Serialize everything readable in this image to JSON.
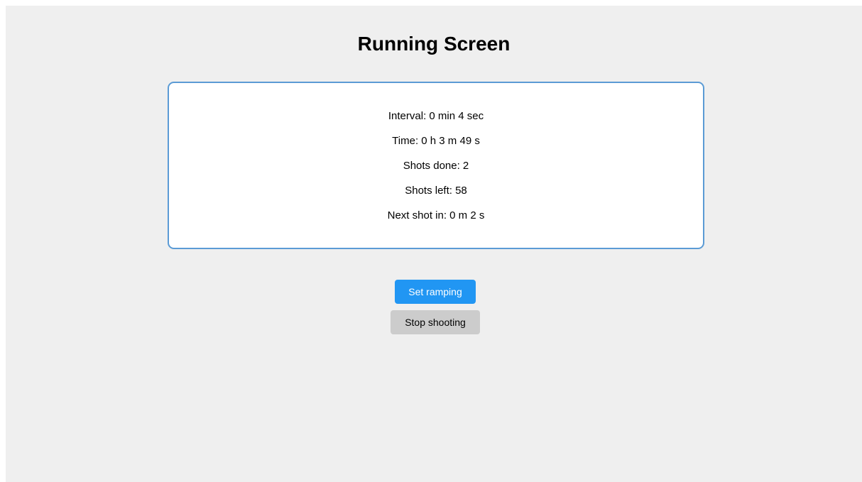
{
  "header": {
    "title": "Running Screen"
  },
  "stats": {
    "interval": "Interval: 0 min 4 sec",
    "time": "Time: 0 h 3 m 49 s",
    "shots_done": "Shots done: 2",
    "shots_left": "Shots left: 58",
    "next_shot": "Next shot in: 0 m 2 s"
  },
  "actions": {
    "set_ramping_label": "Set ramping",
    "stop_shooting_label": "Stop shooting"
  },
  "colors": {
    "background": "#efefef",
    "panel_border": "#5b9bd5",
    "primary_button": "#2196f3",
    "secondary_button": "#cccccc"
  }
}
